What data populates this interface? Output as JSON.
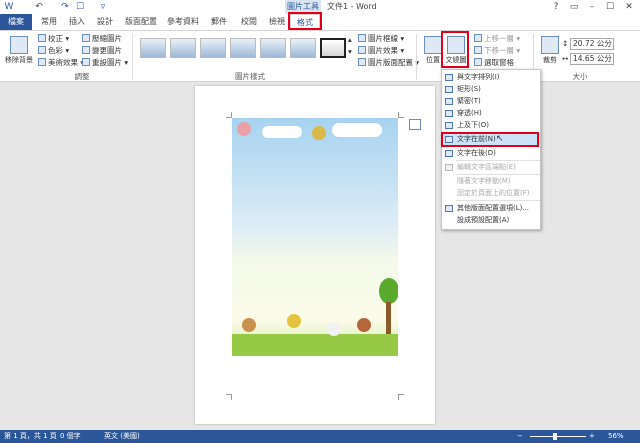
{
  "title_bar": {
    "context_tab_label": "圖片工具",
    "document_title": "文件1 - Word",
    "quick_access": [
      "W",
      "↶",
      "↷",
      "☐",
      "▿"
    ],
    "window_controls": [
      "?",
      "▭",
      "–",
      "☐",
      "✕"
    ]
  },
  "tabs": {
    "file": "檔案",
    "items": [
      "常用",
      "插入",
      "設計",
      "版面配置",
      "參考資料",
      "郵件",
      "校閱",
      "檢視",
      "格式"
    ],
    "active": "格式"
  },
  "ribbon": {
    "remove_background": "移除背景",
    "adjust": {
      "corrections": "校正",
      "color": "色彩",
      "artistic_effects": "美術效果",
      "compress": "壓縮圖片",
      "change": "變更圖片",
      "reset": "重設圖片",
      "group_label": "調整"
    },
    "picture_styles": {
      "border": "圖片框線",
      "effects": "圖片效果",
      "layout": "圖片版面配置",
      "group_label": "圖片樣式"
    },
    "arrange": {
      "position": "位置",
      "wrap_text": "文繞圖",
      "bring_forward": "上移一層",
      "send_backward": "下移一層",
      "selection_pane": "選取窗格"
    },
    "size": {
      "crop": "裁剪",
      "height": "20.72 公分",
      "width": "14.65 公分",
      "group_label": "大小"
    }
  },
  "wrap_menu": {
    "items": [
      {
        "label": "與文字排列(I)",
        "state": "normal"
      },
      {
        "label": "矩形(S)",
        "state": "normal"
      },
      {
        "label": "緊密(T)",
        "state": "normal"
      },
      {
        "label": "穿透(H)",
        "state": "normal"
      },
      {
        "label": "上及下(O)",
        "state": "normal"
      },
      {
        "label": "文字在前(N)",
        "state": "highlighted"
      },
      {
        "label": "文字在後(D)",
        "state": "normal"
      },
      {
        "label": "編輯文字區端點(E)",
        "state": "disabled"
      },
      {
        "label": "隨著文字移動(M)",
        "state": "disabled"
      },
      {
        "label": "固定於頁面上的位置(F)",
        "state": "disabled"
      },
      {
        "label": "其他版面配置選項(L)...",
        "state": "normal"
      },
      {
        "label": "設成預設配置(A)",
        "state": "normal"
      }
    ]
  },
  "status_bar": {
    "page": "第 1 頁，共 1 頁",
    "words": "0 個字",
    "language": "英文 (美國)",
    "zoom": "56%"
  },
  "colors": {
    "accent": "#2b579a",
    "highlight_box": "#e0001b",
    "menu_hover": "#cde3f7"
  }
}
